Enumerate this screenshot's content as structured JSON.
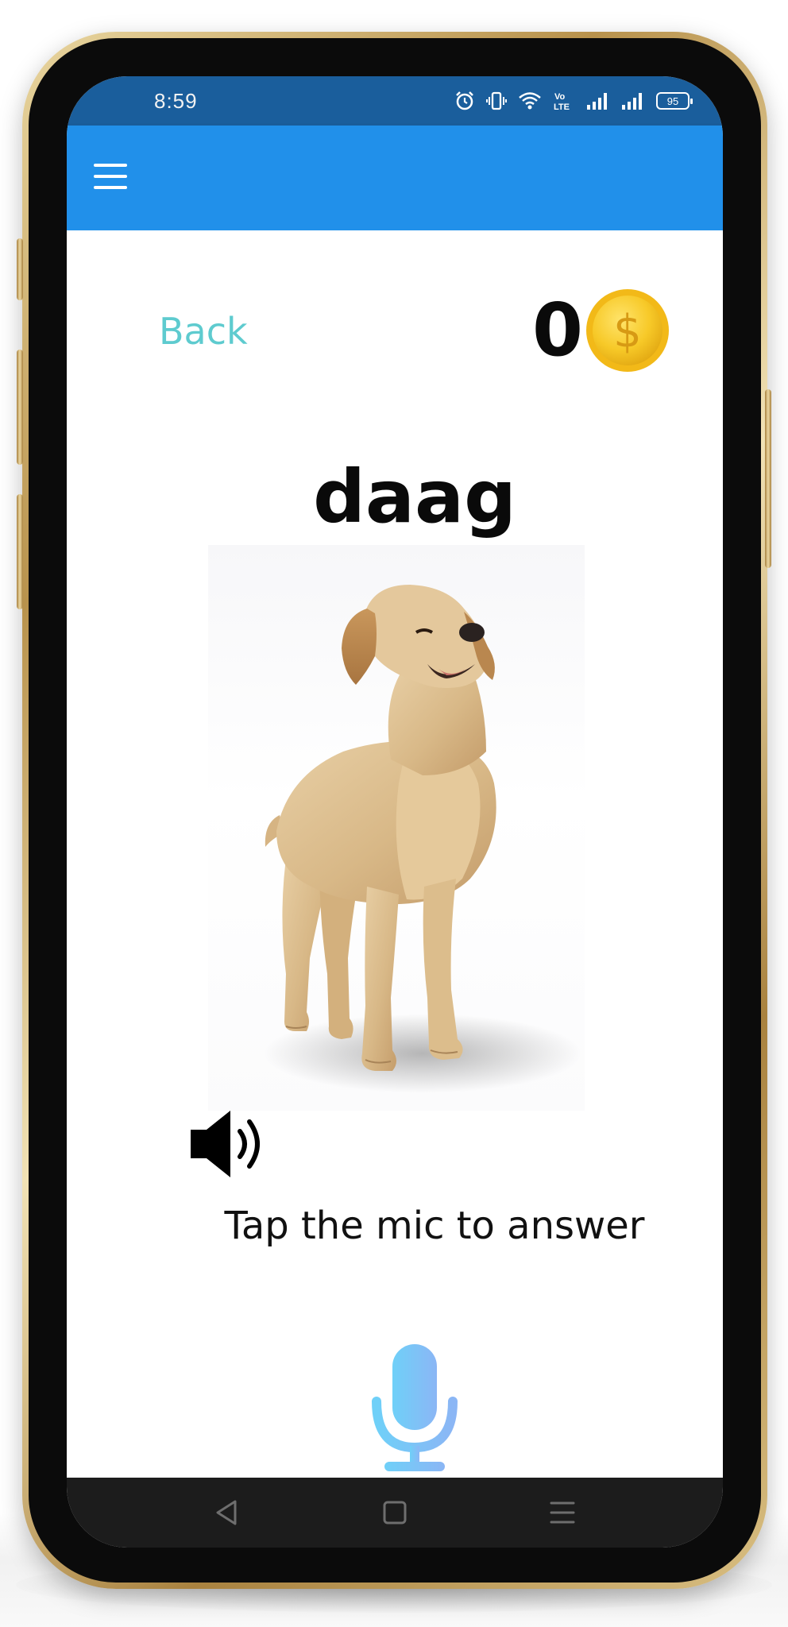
{
  "status_bar": {
    "time": "8:59",
    "battery_level": "95",
    "icons": [
      "alarm-icon",
      "vibrate-icon",
      "wifi-icon",
      "volte-icon",
      "signal-icon",
      "signal-icon",
      "battery-icon"
    ]
  },
  "app_bar": {
    "menu_icon": "hamburger-menu-icon",
    "color": "#2190EA"
  },
  "header": {
    "back_label": "Back",
    "score": "0",
    "coin_icon": "dollar-coin-icon"
  },
  "question": {
    "word": "daag",
    "image_subject": "dog",
    "speaker_icon": "speaker-icon",
    "prompt": "Tap the mic to answer",
    "mic_icon": "microphone-icon"
  },
  "nav_bar": {
    "buttons": [
      "back-triangle-icon",
      "home-square-icon",
      "recents-menu-icon"
    ]
  },
  "colors": {
    "status_bar": "#1A5E9C",
    "app_bar": "#2190EA",
    "back_link": "#5ECBCF",
    "coin": "#F7C928",
    "mic_gradient_start": "#6FD0F8",
    "mic_gradient_end": "#8BB6F5",
    "nav_bar": "#1C1C1C"
  }
}
